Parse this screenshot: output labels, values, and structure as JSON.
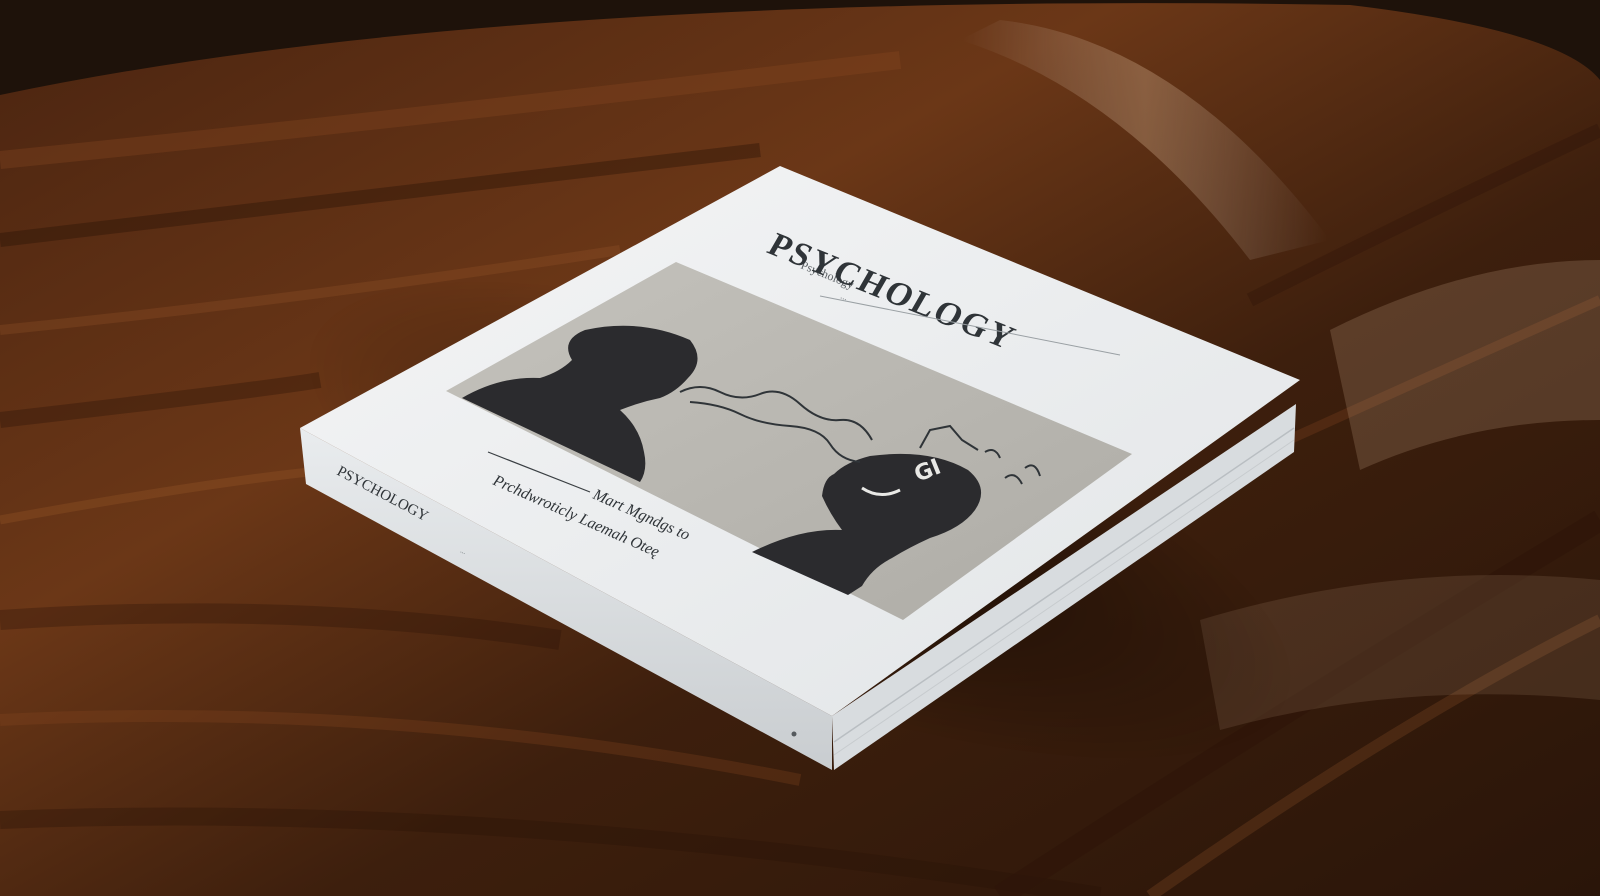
{
  "book": {
    "cover": {
      "overline": "Psychology",
      "title": "PSYCHOLOGY",
      "subline": "...",
      "illustration_glyph": "GI"
    },
    "front_text": {
      "line_1": "Mart Mgndgs to",
      "line_2": "Prchdwroticly Laemah Oteę",
      "small_print": "..."
    },
    "spine": {
      "title": "PSYCHOLOGY"
    }
  },
  "colors": {
    "table_dark": "#2a1509",
    "table_mid": "#5a2e14",
    "table_light": "#8a5a36",
    "cover_white": "#eef0f1",
    "illustration_bg": "#b9b7b1",
    "silhouette": "#2b2b2e",
    "ink": "#2f3438"
  }
}
